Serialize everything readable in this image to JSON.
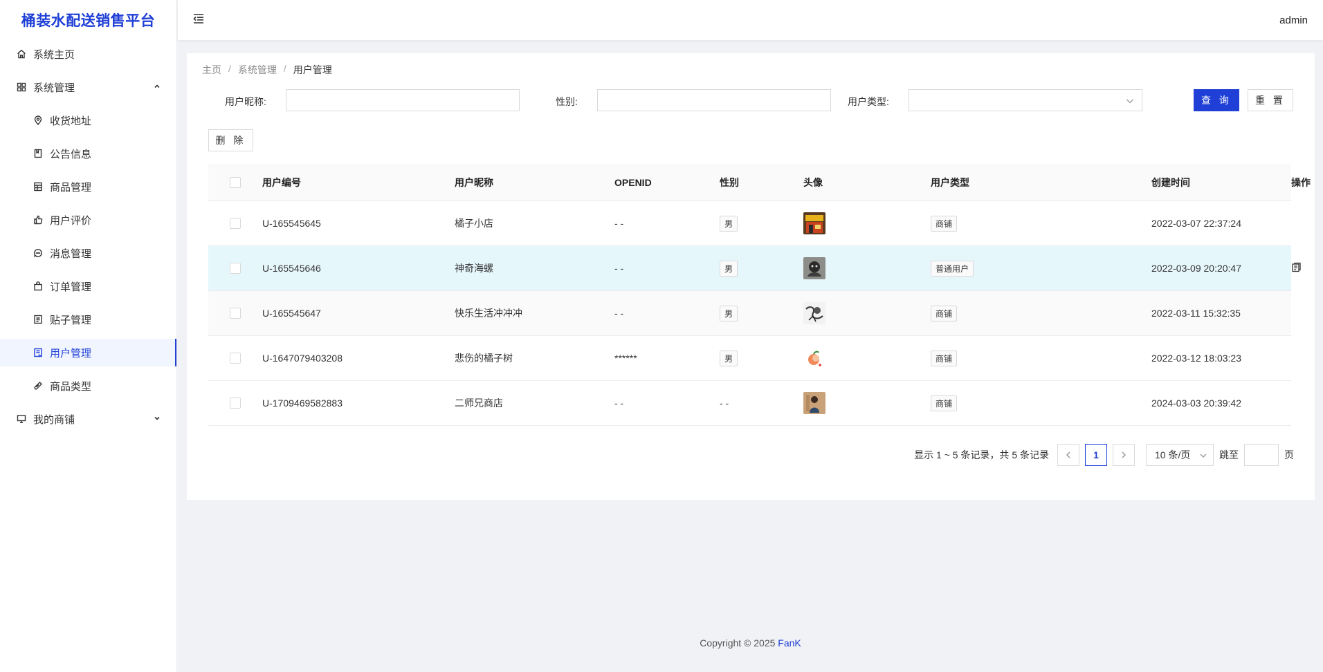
{
  "app": {
    "title": "桶装水配送销售平台"
  },
  "header": {
    "user": "admin"
  },
  "sidebar": {
    "items": [
      {
        "label": "系统主页",
        "icon": "home-icon"
      },
      {
        "label": "系统管理",
        "icon": "grid-icon",
        "expanded": true
      },
      {
        "label": "收货地址",
        "icon": "location-icon"
      },
      {
        "label": "公告信息",
        "icon": "book-icon"
      },
      {
        "label": "商品管理",
        "icon": "product-icon"
      },
      {
        "label": "用户评价",
        "icon": "like-icon"
      },
      {
        "label": "消息管理",
        "icon": "message-icon"
      },
      {
        "label": "订单管理",
        "icon": "bag-icon"
      },
      {
        "label": "贴子管理",
        "icon": "post-icon"
      },
      {
        "label": "用户管理",
        "icon": "user-doc-icon",
        "active": true
      },
      {
        "label": "商品类型",
        "icon": "tag-icon"
      },
      {
        "label": "我的商铺",
        "icon": "monitor-icon",
        "expanded": false
      }
    ]
  },
  "breadcrumb": {
    "home": "主页",
    "section": "系统管理",
    "current": "用户管理"
  },
  "filters": {
    "nickname_label": "用户昵称:",
    "nickname_value": "",
    "gender_label": "性别:",
    "gender_value": "",
    "type_label": "用户类型:",
    "type_value": "",
    "search_label": "查 询",
    "reset_label": "重 置"
  },
  "actions": {
    "delete_label": "删 除"
  },
  "table": {
    "columns": [
      "用户编号",
      "用户昵称",
      "OPENID",
      "性别",
      "头像",
      "用户类型",
      "创建时间",
      "操作"
    ],
    "rows": [
      {
        "id": "U-165545645",
        "nickname": "橘子小店",
        "openid": "- -",
        "gender": "男",
        "gender_tag": true,
        "avatar": "avatar-store",
        "type": "商铺",
        "created": "2022-03-07 22:37:24"
      },
      {
        "id": "U-165545646",
        "nickname": "神奇海螺",
        "openid": "- -",
        "gender": "男",
        "gender_tag": true,
        "avatar": "avatar-dark",
        "type": "普通用户",
        "created": "2022-03-09 20:20:47"
      },
      {
        "id": "U-165545647",
        "nickname": "快乐生活冲冲冲",
        "openid": "- -",
        "gender": "男",
        "gender_tag": true,
        "avatar": "avatar-sketch",
        "type": "商铺",
        "created": "2022-03-11 15:32:35"
      },
      {
        "id": "U-1647079403208",
        "nickname": "悲伤的橘子树",
        "openid": "******",
        "gender": "男",
        "gender_tag": true,
        "avatar": "avatar-peach",
        "type": "商铺",
        "created": "2022-03-12 18:03:23"
      },
      {
        "id": "U-1709469582883",
        "nickname": "二师兄商店",
        "openid": "- -",
        "gender": "- -",
        "gender_tag": false,
        "avatar": "avatar-girl",
        "type": "商铺",
        "created": "2024-03-03 20:39:42"
      }
    ]
  },
  "pagination": {
    "total_text": "显示 1 ~ 5 条记录，共 5 条记录",
    "current_page": "1",
    "page_size": "10 条/页",
    "jump_label": "跳至",
    "page_suffix": "页"
  },
  "footer": {
    "copyright": "Copyright © 2025",
    "author": "FanK"
  },
  "colors": {
    "accent": "#1f3fd6",
    "row_hover": "#e6f7fc"
  }
}
